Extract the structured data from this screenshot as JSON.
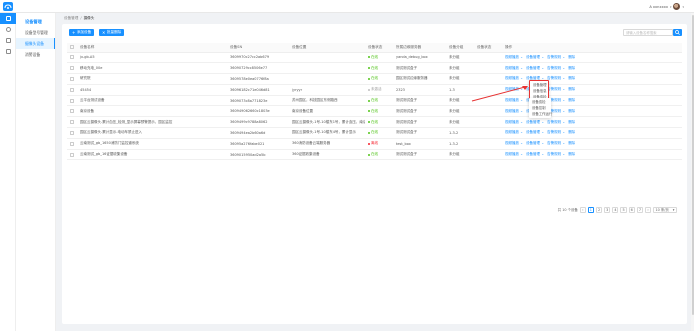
{
  "header": {
    "user_name": "A xxnxxxx"
  },
  "sidebar": {
    "title": "设备管理",
    "items": [
      {
        "label": "设备型号管理"
      },
      {
        "label": "摄像头设备"
      },
      {
        "label": "消警设备"
      }
    ]
  },
  "breadcrumb": {
    "parent": "设备管理",
    "separator": "/",
    "current": "摄像头"
  },
  "toolbar": {
    "add_label": "添加设备",
    "import_label": "批量删除",
    "search_placeholder": "请输入设备名称搜索"
  },
  "table": {
    "columns": [
      "设备名称",
      "设备SN",
      "设备位置",
      "设备状态",
      "所属边缘服务器",
      "设备分组",
      "设备状态",
      "操作"
    ],
    "rows": [
      {
        "name": "jx-gb-A5",
        "sn": "3609970c27cc2ab679",
        "location": "",
        "status": "在线",
        "status_color": "#52c41a",
        "server": "yanda_debug_box",
        "group": "未分组",
        "op3": "告警规则"
      },
      {
        "name": "移动充电_00e",
        "sn": "36090729cc8506e77",
        "location": "",
        "status": "在线",
        "status_color": "#52c41a",
        "server": "测试测试盒子",
        "group": "未分组",
        "op3": "告警规则"
      },
      {
        "name": "研究院",
        "sn": "3609578e0ea0776f8a",
        "location": "",
        "status": "在线",
        "status_color": "#52c41a",
        "server": "园区测试边缘服务器",
        "group": "未分组",
        "op3": "告警规则"
      },
      {
        "name": "45454",
        "sn": "36096182c71e046d81",
        "location": "jyryyr",
        "status": "未激活",
        "status_color": "#bfbfbf",
        "server": "2323",
        "group": "1-3",
        "op3": "告警规则"
      },
      {
        "name": "云平台测试设备",
        "sn": "3609073c8a771823e",
        "location": "苏州园区，科技园区东侧路西",
        "status": "在线",
        "status_color": "#52c41a",
        "server": "测试测试盒子",
        "group": "未分组",
        "op3": "告警规则"
      },
      {
        "name": "南京设备",
        "sn": "360949062660c1803e",
        "location": "南京设备位置",
        "status": "在线",
        "status_color": "#52c41a",
        "server": "测试测试盒子",
        "group": "未分组",
        "op3": "告警规则"
      },
      {
        "name": "园区云摄像头-累计血压_检测_显示屏幕预警提示，园区监控",
        "sn": "3609499c9788a8062",
        "location": "园区云摄像头-1号-10楼东1号，累计血压，南京市",
        "status": "在线",
        "status_color": "#52c41a",
        "server": "测试测试盒子",
        "group": "未分组",
        "op3": "告警规则"
      },
      {
        "name": "园区云摄像头-累计显示-电动车禁止进入",
        "sn": "3609494ea2b60a6d",
        "location": "园区云摄像头-1号-10楼东4号，累计显示",
        "status": "在线",
        "status_color": "#52c41a",
        "server": "测试测试盒子",
        "group": "1-3-2",
        "op3": "告警规则"
      },
      {
        "name": "云南测试_gb_1650消防门监控道系统",
        "sn": "36095a276fabe021",
        "location": "360消防设备云端服务器",
        "status": "离线",
        "status_color": "#f5222d",
        "server": "test_box",
        "group": "1-3-2",
        "op3": "告警规则"
      },
      {
        "name": "云南测试_gb_16证据收集设备",
        "sn": "3609015950ad2a5b",
        "location": "360证据收集设备",
        "status": "在线",
        "status_color": "#52c41a",
        "server": "测试测试盒子",
        "group": "未分组",
        "op3": "告警规则"
      }
    ],
    "op1_label": "视频播放",
    "op2_label": "设备管理",
    "op4_label": "删除",
    "chevron": "⌄"
  },
  "dropdown_primary": {
    "items": [
      "设备管理",
      "设备信息",
      "设备巡检"
    ]
  },
  "dropdown_secondary": {
    "items": [
      "设备巡检",
      "设备控制",
      "设备工作运行"
    ]
  },
  "pagination": {
    "total": "共 10 个设备",
    "pages": [
      "1",
      "2",
      "3",
      "4",
      "5",
      "6",
      "7"
    ],
    "current": "1",
    "prev": "‹",
    "next": "›",
    "page_size": "10 条/页"
  }
}
